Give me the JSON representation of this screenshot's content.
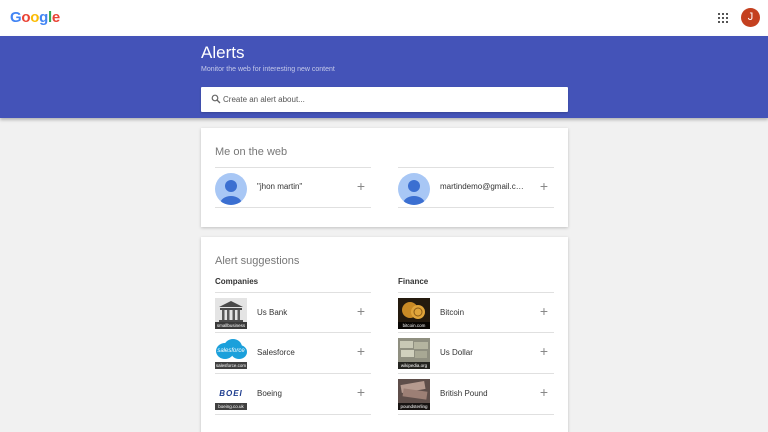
{
  "header": {
    "logo": {
      "g1": "G",
      "o1": "o",
      "o2": "o",
      "g2": "g",
      "l": "l",
      "e": "e"
    },
    "avatar_letter": "J"
  },
  "banner": {
    "title": "Alerts",
    "subtitle": "Monitor the web for interesting new content",
    "search_placeholder": "Create an alert about..."
  },
  "me_on_web": {
    "title": "Me on the web",
    "items": [
      {
        "label": "\"jhon martin\""
      },
      {
        "label": "martindemo@gmail.com"
      }
    ]
  },
  "suggestions": {
    "title": "Alert suggestions",
    "companies": {
      "heading": "Companies",
      "items": [
        {
          "label": "Us Bank",
          "source": "smallbusiness"
        },
        {
          "label": "Salesforce",
          "source": "salesforce.com",
          "logo_text": "salesforce"
        },
        {
          "label": "Boeing",
          "source": "boeing.co.uk",
          "logo_text": "BOEI"
        }
      ]
    },
    "finance": {
      "heading": "Finance",
      "items": [
        {
          "label": "Bitcoin",
          "source": "bitcoin.com"
        },
        {
          "label": "Us Dollar",
          "source": "wikipedia.org"
        },
        {
          "label": "British Pound",
          "source": "poundsterling"
        }
      ]
    }
  },
  "colors": {
    "banner": "#4453b8",
    "avatar": "#c4401f",
    "person_avatar": "#a8c7f5"
  }
}
